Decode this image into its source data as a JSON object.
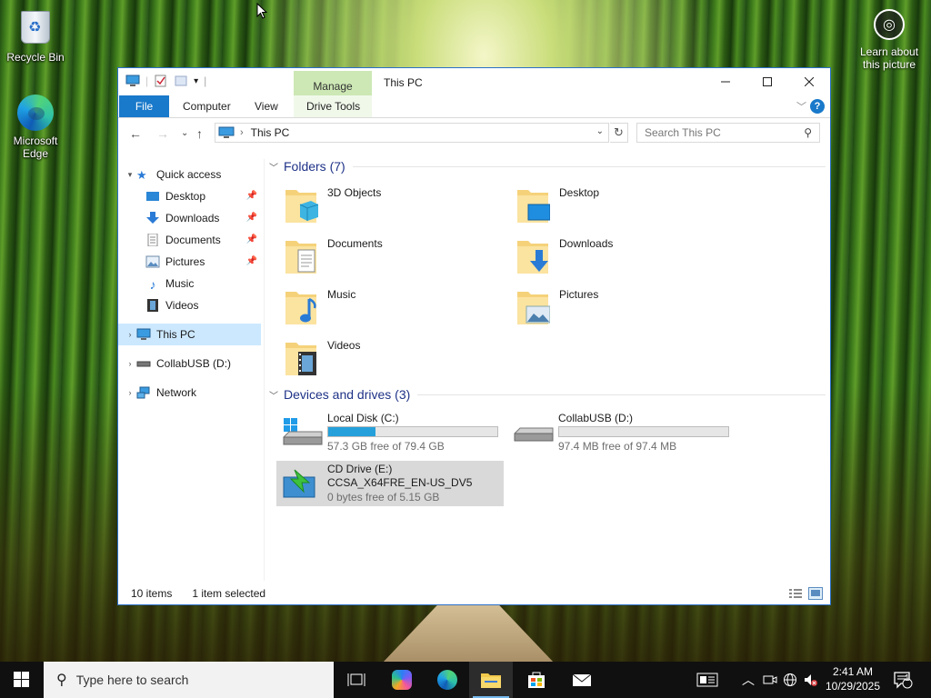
{
  "desktop": {
    "icons": [
      {
        "label": "Recycle Bin"
      },
      {
        "label": "Microsoft Edge"
      }
    ],
    "learn_label": "Learn about this picture"
  },
  "window": {
    "title": "This PC",
    "context_tab": "Manage",
    "tabs": [
      "File",
      "Computer",
      "View",
      "Drive Tools"
    ],
    "address": "This PC",
    "search_placeholder": "Search This PC",
    "nav": {
      "quick_access": "Quick access",
      "quick_items": [
        "Desktop",
        "Downloads",
        "Documents",
        "Pictures",
        "Music",
        "Videos"
      ],
      "this_pc": "This PC",
      "usb": "CollabUSB (D:)",
      "network": "Network"
    },
    "folders_header": "Folders (7)",
    "folders": [
      "3D Objects",
      "Desktop",
      "Documents",
      "Downloads",
      "Music",
      "Pictures",
      "Videos"
    ],
    "devices_header": "Devices and drives (3)",
    "drives": [
      {
        "name": "Local Disk (C:)",
        "free": "57.3 GB free of 79.4 GB",
        "used_fraction": 0.28
      },
      {
        "name": "CollabUSB (D:)",
        "free": "97.4 MB free of 97.4 MB",
        "used_fraction": 0.0
      },
      {
        "name": "CD Drive (E:)",
        "label": "CCSA_X64FRE_EN-US_DV5",
        "free": "0 bytes free of 5.15 GB"
      }
    ],
    "status_items": "10 items",
    "status_selected": "1 item selected"
  },
  "taskbar": {
    "search_placeholder": "Type here to search",
    "time": "2:41 AM",
    "date": "10/29/2025",
    "notification_count": "1"
  },
  "colors": {
    "accent": "#1979ca",
    "context_tab": "#cde8b5",
    "selection": "#cce8ff",
    "drive_bar": "#26a0da"
  }
}
